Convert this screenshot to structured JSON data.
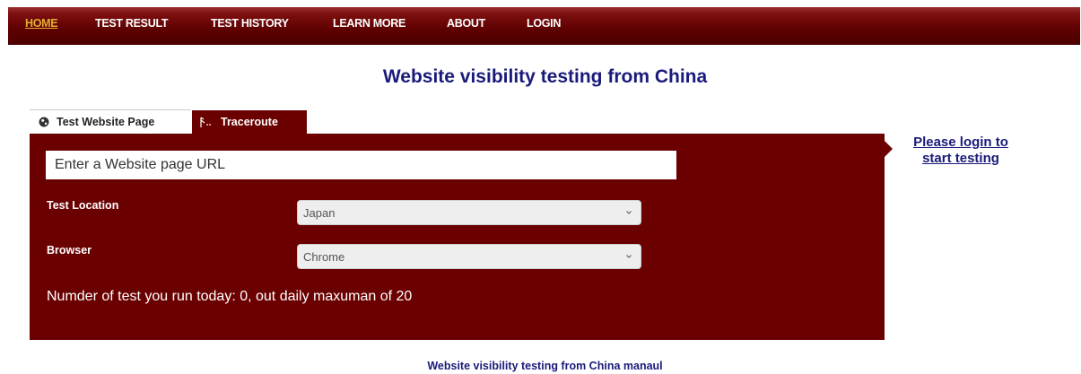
{
  "nav": {
    "items": [
      {
        "label": "HOME",
        "active": true
      },
      {
        "label": "TEST RESULT",
        "active": false
      },
      {
        "label": "TEST HISTORY",
        "active": false
      },
      {
        "label": "LEARN MORE",
        "active": false
      },
      {
        "label": "ABOUT",
        "active": false
      },
      {
        "label": "LOGIN",
        "active": false
      }
    ]
  },
  "page": {
    "title": "Website visibility testing from China"
  },
  "tabs": [
    {
      "label": "Test Website Page",
      "icon": "globe-icon",
      "active": true
    },
    {
      "label": "Traceroute",
      "icon": "traceroute-icon",
      "active": false
    }
  ],
  "form": {
    "url_placeholder": "Enter a Website page URL",
    "location_label": "Test Location",
    "location_value": "Japan",
    "browser_label": "Browser",
    "browser_value": "Chrome",
    "quota_text": "Numder of test you run today: 0, out daily maxuman of 20"
  },
  "sidebar": {
    "login_line1": "Please login to",
    "login_line2": "start testing"
  },
  "footer": {
    "manual_link": "Website visibility testing from China manaul"
  },
  "colors": {
    "navbar": "#5e0000",
    "panel": "#6b0000",
    "active_nav": "#e0b030",
    "title": "#1a1a7a"
  }
}
